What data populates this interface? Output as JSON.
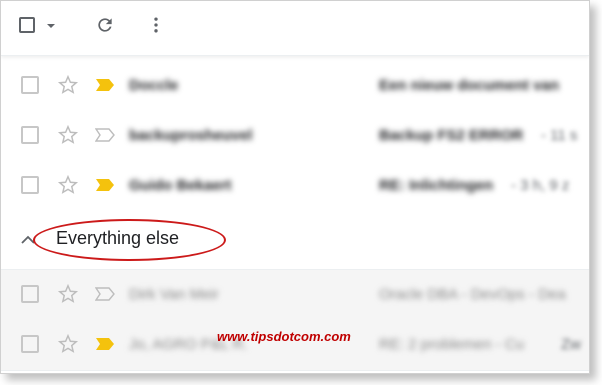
{
  "toolbar": {
    "icons": [
      "checkbox-icon",
      "caret-down-icon",
      "refresh-icon",
      "more-vert-icon"
    ]
  },
  "rows_top": [
    {
      "sender": "Doccle",
      "subject": "Een nieuw document van",
      "snippet": "",
      "important": true
    },
    {
      "sender": "backuprosheuvel",
      "subject": "Backup FS2 ERROR",
      "snippet": "- 11 s",
      "important": false
    },
    {
      "sender": "Guido Bekaert",
      "subject": "RE: Inlichtingen",
      "snippet": "- 3 h, 9 z",
      "important": true
    }
  ],
  "section": {
    "title": "Everything else",
    "chevron": "chevron-up-icon"
  },
  "rows_bottom": [
    {
      "sender": "Dirk Van Meir",
      "subject": "Oracle DBA - DevOps - Dea",
      "snippet": "",
      "important": false
    },
    {
      "sender": "Jo, AGRO P&L R.",
      "subject": "RE: 2 problemen - Cu",
      "snippet": "Zw",
      "important": true
    }
  ],
  "watermark": "www.tipsdotcom.com",
  "colors": {
    "important": "#f4c20d",
    "annotation": "#cc1a1a",
    "watermark": "#c00000"
  }
}
